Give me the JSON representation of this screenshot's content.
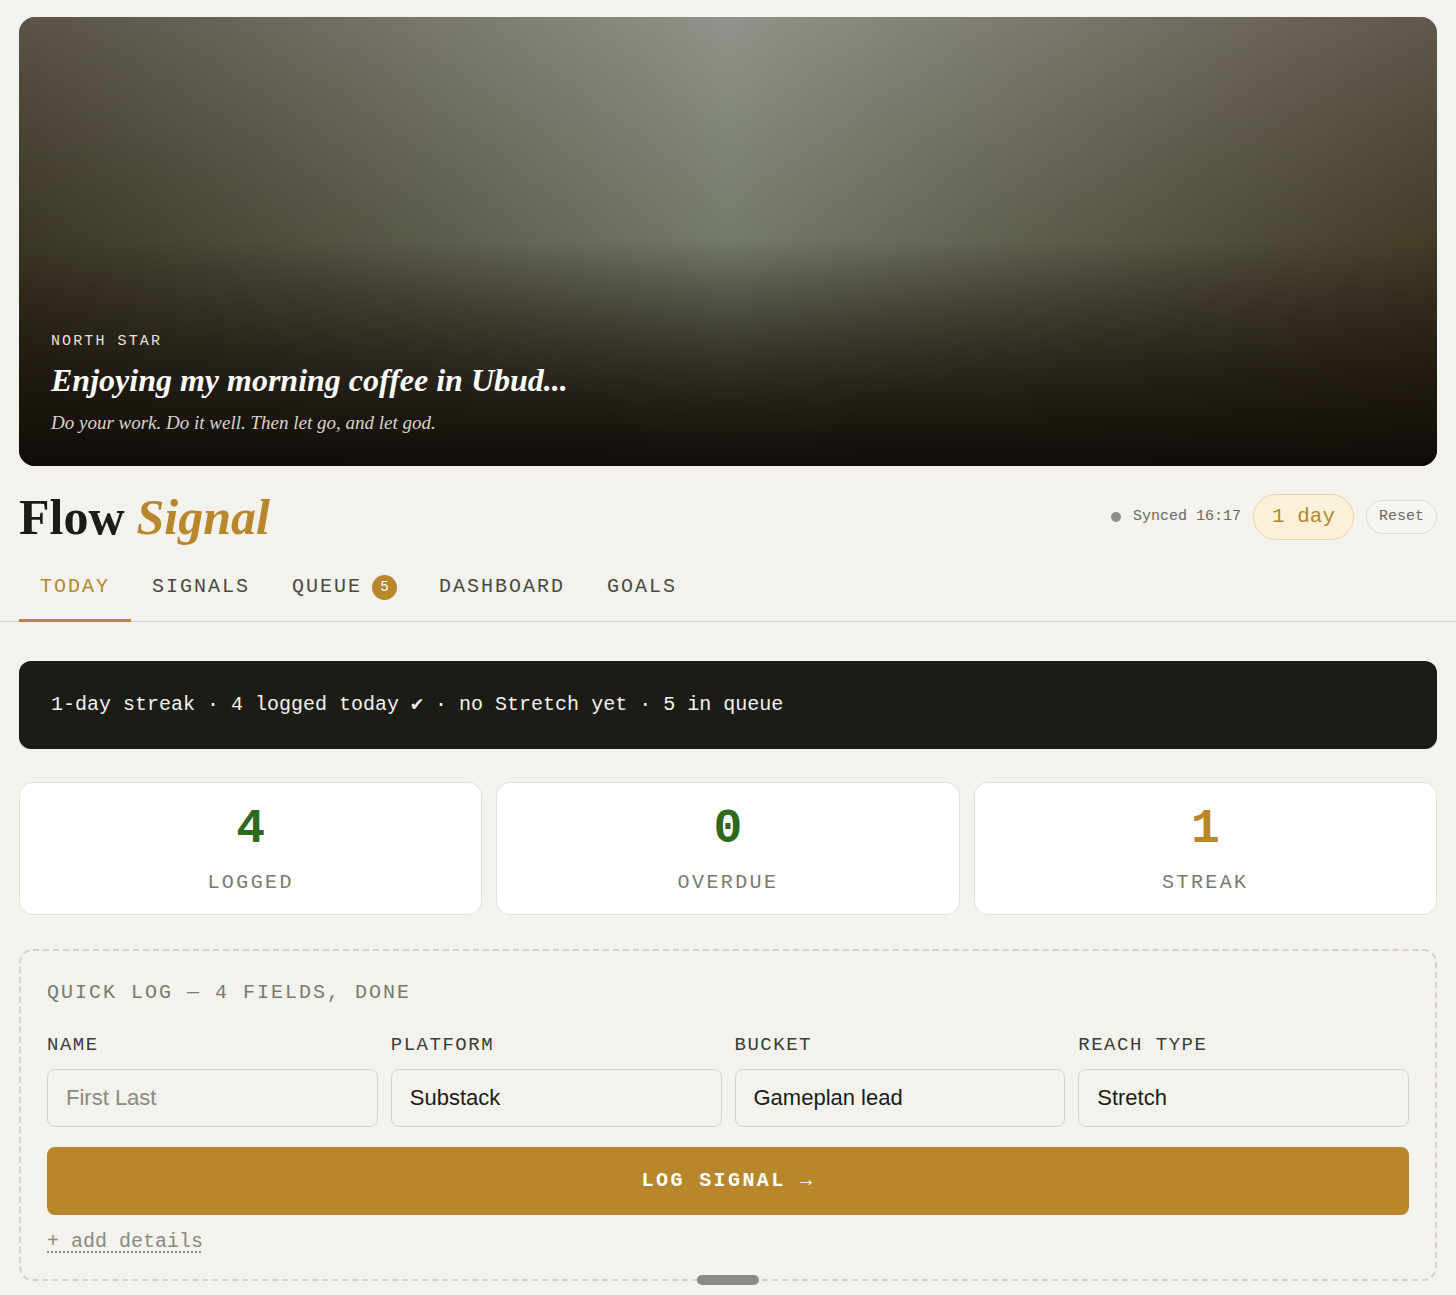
{
  "hero": {
    "eyebrow": "NORTH STAR",
    "title": "Enjoying my morning coffee in Ubud...",
    "quote": "Do your work. Do it well. Then let go, and let god."
  },
  "header": {
    "logo_first": "Flow",
    "logo_second": "Signal",
    "sync": "Synced 16:17",
    "streak_pill": "1 day",
    "reset": "Reset"
  },
  "tabs": [
    {
      "label": "TODAY",
      "selected": true,
      "badge": ""
    },
    {
      "label": "SIGNALS",
      "selected": false,
      "badge": ""
    },
    {
      "label": "QUEUE",
      "selected": false,
      "badge": "5"
    },
    {
      "label": "DASHBOARD",
      "selected": false,
      "badge": ""
    },
    {
      "label": "GOALS",
      "selected": false,
      "badge": ""
    }
  ],
  "banner": "1-day streak · 4 logged today ✔ · no Stretch yet · 5 in queue",
  "stats": [
    {
      "value": "4",
      "label": "LOGGED",
      "color": "#2f6a1c"
    },
    {
      "value": "0",
      "label": "OVERDUE",
      "color": "#2f6a1c"
    },
    {
      "value": "1",
      "label": "STREAK",
      "color": "#b8862b"
    }
  ],
  "quick_log": {
    "title": "QUICK LOG — 4 FIELDS, DONE",
    "fields": [
      {
        "label": "NAME",
        "kind": "text",
        "placeholder": "First Last",
        "value": ""
      },
      {
        "label": "PLATFORM",
        "kind": "select",
        "placeholder": "",
        "value": "Substack"
      },
      {
        "label": "BUCKET",
        "kind": "select",
        "placeholder": "",
        "value": "Gameplan lead"
      },
      {
        "label": "REACH TYPE",
        "kind": "select",
        "placeholder": "",
        "value": "Stretch"
      }
    ],
    "submit": "LOG SIGNAL →",
    "details_link": "+ add details"
  }
}
